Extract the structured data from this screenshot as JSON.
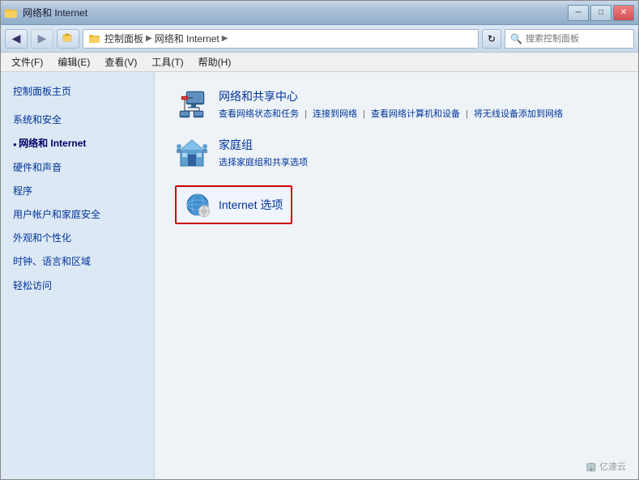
{
  "window": {
    "title": "网络和 Internet",
    "title_buttons": {
      "minimize": "─",
      "maximize": "□",
      "close": "✕"
    }
  },
  "address_bar": {
    "back_tooltip": "后退",
    "forward_tooltip": "前进",
    "path": {
      "part1": "控制面板",
      "arrow1": "▶",
      "part2": "网络和 Internet",
      "arrow2": "▶"
    },
    "refresh_icon": "↻",
    "search_placeholder": "搜索控制面板",
    "search_icon": "🔍"
  },
  "menu_bar": {
    "items": [
      {
        "label": "文件(F)"
      },
      {
        "label": "编辑(E)"
      },
      {
        "label": "查看(V)"
      },
      {
        "label": "工具(T)"
      },
      {
        "label": "帮助(H)"
      }
    ]
  },
  "sidebar": {
    "items": [
      {
        "label": "控制面板主页",
        "active": false
      },
      {
        "label": "系统和安全",
        "active": false
      },
      {
        "label": "网络和 Internet",
        "active": true
      },
      {
        "label": "硬件和声音",
        "active": false
      },
      {
        "label": "程序",
        "active": false
      },
      {
        "label": "用户帐户和家庭安全",
        "active": false
      },
      {
        "label": "外观和个性化",
        "active": false
      },
      {
        "label": "时钟、语言和区域",
        "active": false
      },
      {
        "label": "轻松访问",
        "active": false
      }
    ]
  },
  "main": {
    "items": [
      {
        "id": "network-sharing",
        "title": "网络和共享中心",
        "links": [
          "查看网络状态和任务",
          "连接到网络",
          "查看网络计算机和设备",
          "将无线设备添加到网络"
        ]
      },
      {
        "id": "homegroup",
        "title": "家庭组",
        "links": [
          "选择家庭组和共享选项"
        ]
      },
      {
        "id": "internet-options",
        "title": "Internet 选项",
        "links": []
      }
    ]
  },
  "watermark": "🏢 亿速云"
}
